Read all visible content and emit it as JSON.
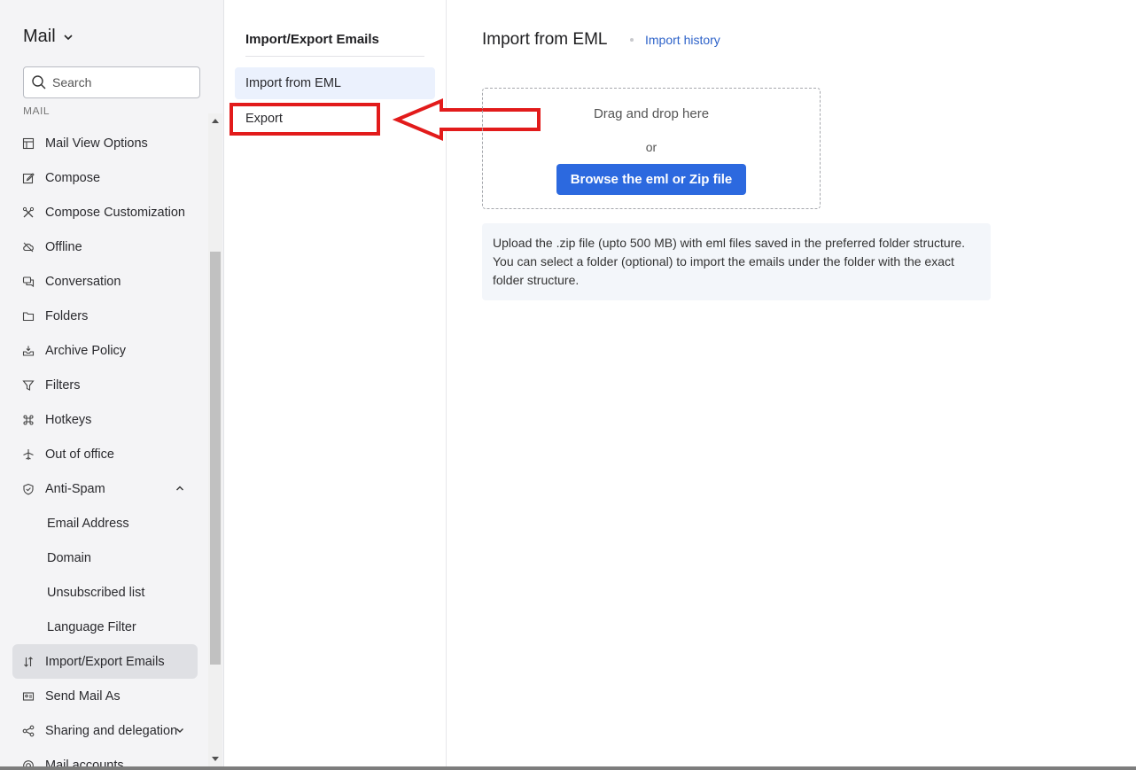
{
  "sidebar": {
    "app_title": "Mail",
    "search_placeholder": "Search",
    "section_label": "MAIL",
    "items": [
      {
        "label": "Mail View Options",
        "icon": "layout-icon"
      },
      {
        "label": "Compose",
        "icon": "edit-icon"
      },
      {
        "label": "Compose Customization",
        "icon": "tools-icon"
      },
      {
        "label": "Offline",
        "icon": "cloud-off-icon"
      },
      {
        "label": "Conversation",
        "icon": "chat-icon"
      },
      {
        "label": "Folders",
        "icon": "folder-icon"
      },
      {
        "label": "Archive Policy",
        "icon": "archive-icon"
      },
      {
        "label": "Filters",
        "icon": "filter-icon"
      },
      {
        "label": "Hotkeys",
        "icon": "command-icon"
      },
      {
        "label": "Out of office",
        "icon": "plane-icon"
      },
      {
        "label": "Anti-Spam",
        "icon": "shield-icon"
      },
      {
        "label": "Email Address"
      },
      {
        "label": "Domain"
      },
      {
        "label": "Unsubscribed list"
      },
      {
        "label": "Language Filter"
      },
      {
        "label": "Import/Export Emails",
        "icon": "import-export-icon"
      },
      {
        "label": "Send Mail As",
        "icon": "send-as-icon"
      },
      {
        "label": "Sharing and delegation",
        "icon": "share-icon"
      },
      {
        "label": "Mail accounts",
        "icon": "at-icon"
      }
    ]
  },
  "middle": {
    "title": "Import/Export Emails",
    "items": [
      {
        "label": "Import from EML"
      },
      {
        "label": "Export"
      }
    ]
  },
  "main": {
    "title": "Import from EML",
    "history_link": "Import history",
    "dropzone": {
      "text": "Drag and drop here",
      "or": "or",
      "button": "Browse the eml or Zip file"
    },
    "info_line1": "Upload the .zip file (upto 500 MB) with eml files saved in the preferred folder structure.",
    "info_line2": "You can select a folder (optional) to import the emails under the folder with the exact",
    "info_line3": "folder structure."
  },
  "colors": {
    "accent": "#2c69df",
    "annotation": "#e21b1b",
    "active_bg": "#dfe0e4"
  }
}
